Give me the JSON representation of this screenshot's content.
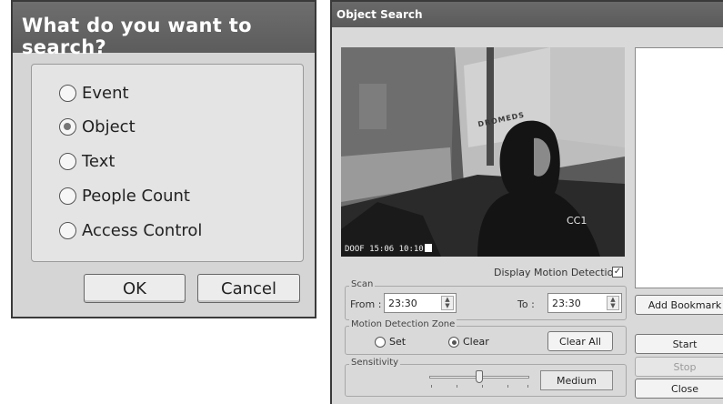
{
  "search_type_dialog": {
    "title": "What do you want to search?",
    "options": [
      {
        "label": "Event",
        "selected": false
      },
      {
        "label": "Object",
        "selected": true
      },
      {
        "label": "Text",
        "selected": false
      },
      {
        "label": "People Count",
        "selected": false
      },
      {
        "label": "Access Control",
        "selected": false
      }
    ],
    "ok_label": "OK",
    "cancel_label": "Cancel"
  },
  "object_search": {
    "title": "Object Search",
    "video": {
      "camera_label": "CC1",
      "timestamp": "DOOF 15:06 10:10",
      "watermark": "DROMEDS"
    },
    "display_motion_detection": {
      "label": "Display Motion Detection",
      "checked": true
    },
    "scan": {
      "legend": "Scan",
      "from_label": "From :",
      "from_value": "23:30",
      "to_label": "To :",
      "to_value": "23:30"
    },
    "motion_zone": {
      "legend": "Motion Detection Zone",
      "set_label": "Set",
      "clear_label": "Clear",
      "selected": "Clear",
      "clear_all_label": "Clear All"
    },
    "sensitivity": {
      "legend": "Sensitivity",
      "level": 0.5,
      "value_label": "Medium"
    },
    "buttons": {
      "add_bookmark": "Add Bookmark",
      "start": "Start",
      "stop": "Stop",
      "close": "Close"
    }
  },
  "colors": {
    "titlebar": "#5f5f5f",
    "dialog_bg": "#d5d5d5",
    "panel_bg": "#e4e4e4"
  }
}
